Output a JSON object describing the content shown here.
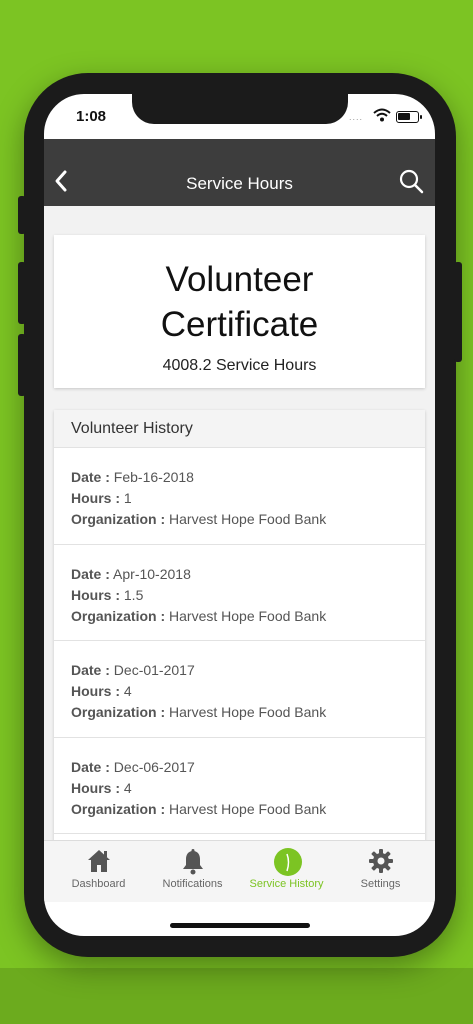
{
  "status_bar": {
    "time": "1:08",
    "signal_dots": "....",
    "icons": [
      "wifi-icon",
      "battery-icon"
    ]
  },
  "header": {
    "title": "Service Hours",
    "back_icon": "chevron-left-icon",
    "search_icon": "search-icon"
  },
  "certificate": {
    "title_line1": "Volunteer",
    "title_line2": "Certificate",
    "hours_text": "4008.2 Service Hours"
  },
  "history": {
    "heading": "Volunteer History",
    "date_label": "Date :",
    "hours_label": "Hours :",
    "org_label": "Organization :",
    "entries": [
      {
        "date": "Feb-16-2018",
        "hours": "1",
        "organization": "Harvest Hope Food Bank"
      },
      {
        "date": "Apr-10-2018",
        "hours": "1.5",
        "organization": "Harvest Hope Food Bank"
      },
      {
        "date": "Dec-01-2017",
        "hours": "4",
        "organization": "Harvest Hope Food Bank"
      },
      {
        "date": "Dec-06-2017",
        "hours": "4",
        "organization": "Harvest Hope Food Bank"
      }
    ]
  },
  "tabbar": {
    "tabs": [
      {
        "label": "Dashboard",
        "icon": "home-icon"
      },
      {
        "label": "Notifications",
        "icon": "bell-icon"
      },
      {
        "label": "Service History",
        "icon": "service-history-icon",
        "active": true
      },
      {
        "label": "Settings",
        "icon": "gear-icon"
      }
    ]
  },
  "colors": {
    "accent": "#7cc423",
    "background": "#7cc423",
    "navbar": "#3d3d3d"
  }
}
